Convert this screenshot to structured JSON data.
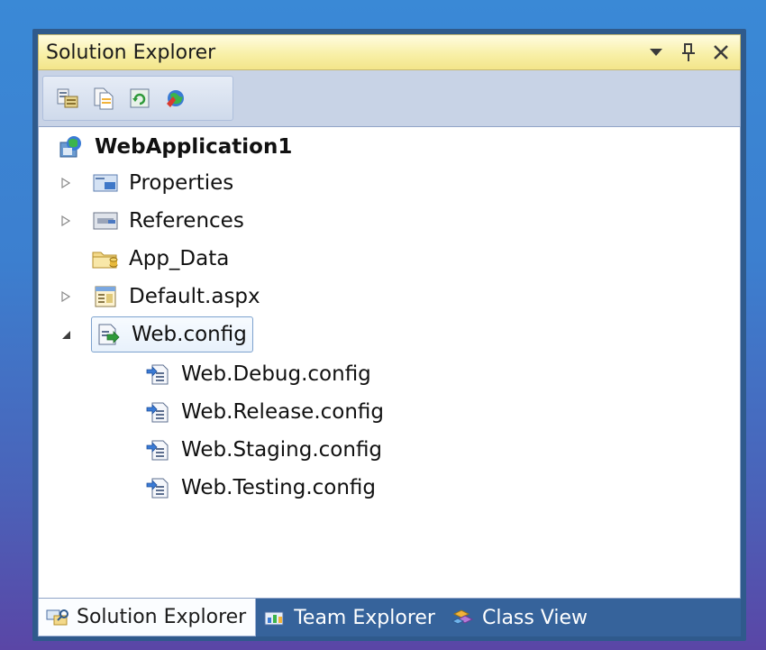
{
  "window": {
    "title": "Solution Explorer",
    "title_buttons": [
      "dropdown-arrow",
      "pin",
      "close"
    ]
  },
  "toolbar": {
    "icons": [
      "properties-icon",
      "show-all-files-icon",
      "refresh-icon",
      "copy-web-site-icon"
    ]
  },
  "tree": {
    "root": "WebApplication1",
    "items": [
      {
        "label": "Properties",
        "expander": "collapsed"
      },
      {
        "label": "References",
        "expander": "collapsed"
      },
      {
        "label": "App_Data",
        "expander": "none"
      },
      {
        "label": "Default.aspx",
        "expander": "collapsed"
      },
      {
        "label": "Web.config",
        "expander": "expanded",
        "selected": true
      },
      {
        "label": "Web.Debug.config",
        "child": true
      },
      {
        "label": "Web.Release.config",
        "child": true
      },
      {
        "label": "Web.Staging.config",
        "child": true
      },
      {
        "label": "Web.Testing.config",
        "child": true
      }
    ]
  },
  "tabs": [
    {
      "label": "Solution Explorer",
      "active": true
    },
    {
      "label": "Team Explorer",
      "active": false
    },
    {
      "label": "Class View",
      "active": false
    }
  ]
}
